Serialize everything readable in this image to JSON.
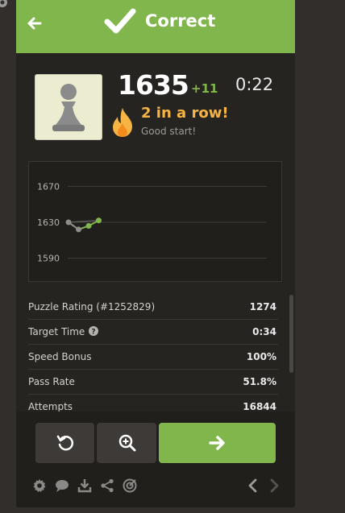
{
  "header": {
    "title": "Correct"
  },
  "player": {
    "rating": "1635",
    "rating_delta": "+11",
    "timer": "0:22"
  },
  "streak": {
    "title": "2 in a row!",
    "subtitle": "Good start!"
  },
  "chart_data": {
    "type": "line",
    "title": "",
    "xlabel": "",
    "ylabel": "",
    "y_ticks": [
      "1670",
      "1630",
      "1590"
    ],
    "ylim": [
      1570,
      1690
    ],
    "grid": true,
    "series": [
      {
        "values": [
          1630,
          1622,
          1626,
          1632
        ]
      }
    ]
  },
  "stats": [
    {
      "label": "Puzzle Rating (#1252829)",
      "value": "1274"
    },
    {
      "label": "Target Time",
      "value": "0:34"
    },
    {
      "label": "Speed Bonus",
      "value": "100%"
    },
    {
      "label": "Pass Rate",
      "value": "51.8%"
    },
    {
      "label": "Attempts",
      "value": "16844"
    }
  ],
  "colors": {
    "accent": "#81b64c",
    "streak": "#f6b445",
    "background": "#262421"
  },
  "icons": [
    "gear-icon",
    "back-arrow-icon",
    "checkmark-icon",
    "pawn-icon",
    "flame-icon",
    "info-icon",
    "retry-icon",
    "analysis-icon",
    "next-arrow-icon",
    "chat-icon",
    "download-icon",
    "share-icon",
    "target-icon",
    "chevron-left-icon",
    "chevron-right-icon"
  ]
}
